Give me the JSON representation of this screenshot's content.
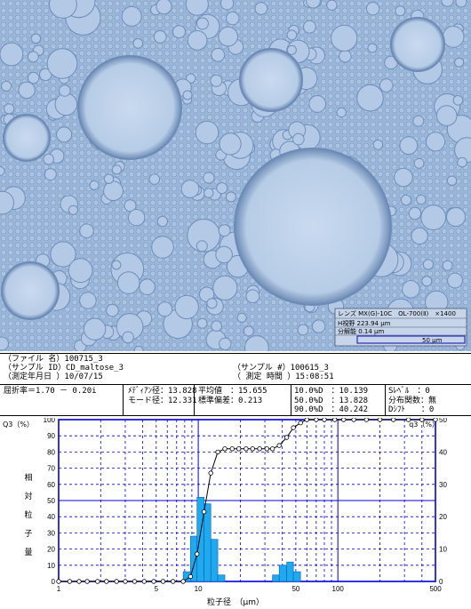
{
  "micro": {
    "lens_label": "レンズ",
    "lens_value": "MX(G)-10C　OL-700(Ⅱ)　×1400",
    "fov_label": "H視野",
    "fov_value": "223.94 μm",
    "res_label": "分解能",
    "res_value": "0.14 μm",
    "scale_label": "50 μm",
    "colors": {
      "background": "#9db9da",
      "particle_fill": "#bfd2ea",
      "particle_edge": "#6c8bb6"
    }
  },
  "header": {
    "file_label": "（ファイル 名）",
    "file_value": "100715_3",
    "sample_id_label": "（サンプル ID）",
    "sample_id_value": "CD_maltose_3",
    "date_label": "（測定年月日 ）",
    "date_value": "10/07/15",
    "sample_no_label": "（サンプル #）",
    "sample_no_value": "100615_3",
    "time_label": "（ 測定 時間 ）",
    "time_value": "15:08:51"
  },
  "stats": {
    "refractive": "屈折率＝1.70 － 0.20i",
    "median_label": "ﾒﾃﾞｨｱﾝ径：",
    "median_value": "13.828",
    "mode_label": "モード径：",
    "mode_value": "12.331",
    "mean_label": "平均値　：",
    "mean_value": "15.655",
    "sd_label": "標準偏差：",
    "sd_value": "0.213",
    "d10_label": "10.0%D　：",
    "d10_value": "10.139",
    "d50_label": "50.0%D　：",
    "d50_value": "13.828",
    "d90_label": "90.0%D　：",
    "d90_value": "40.242",
    "slevel_label": "Sﾚﾍﾞﾙ　：",
    "slevel_value": "0",
    "dist_label": "分布関数：",
    "dist_value": "無",
    "dshift_label": "Dｼﾌﾄ　　：",
    "dshift_value": "0"
  },
  "chart_data": {
    "type": "bar",
    "xscale": "log",
    "xlim": [
      1,
      500
    ],
    "xticks": [
      "1",
      "5",
      "10",
      "50",
      "100",
      "500"
    ],
    "xlabel": "粒子径　（μm）",
    "ylabel_left": "相対粒子量",
    "left_axis_title": "Q3（%）",
    "right_axis_title": "q3（%）",
    "ylim_left": [
      0,
      100
    ],
    "ylim_right": [
      0,
      50
    ],
    "yticks_left": [
      "0",
      "10",
      "20",
      "30",
      "40",
      "50",
      "60",
      "70",
      "80",
      "90",
      "100"
    ],
    "yticks_right": [
      "0",
      "10",
      "20",
      "30",
      "40",
      "50"
    ],
    "colors": {
      "axes": "#0000dd",
      "bars": "#1faaf0",
      "bar_edge": "#0a5fb0",
      "curve": "#000000"
    },
    "series": [
      {
        "kind": "bars (q3, right axis)",
        "bins": [
          [
            7.8,
            8.8,
            3
          ],
          [
            8.8,
            9.8,
            14
          ],
          [
            9.8,
            11.0,
            26
          ],
          [
            11.0,
            12.3,
            24
          ],
          [
            12.3,
            13.8,
            13
          ],
          [
            13.8,
            15.5,
            2
          ],
          [
            34,
            38,
            2
          ],
          [
            38,
            43,
            5
          ],
          [
            43,
            48,
            6
          ],
          [
            48,
            54,
            3
          ]
        ]
      },
      {
        "kind": "line (Q3 cumulative, left axis)",
        "points": [
          [
            1,
            0
          ],
          [
            1.2,
            0
          ],
          [
            1.4,
            0
          ],
          [
            1.6,
            0
          ],
          [
            1.9,
            0
          ],
          [
            2.2,
            0
          ],
          [
            2.6,
            0
          ],
          [
            3,
            0
          ],
          [
            3.5,
            0
          ],
          [
            4.1,
            0
          ],
          [
            4.8,
            0
          ],
          [
            5.6,
            0
          ],
          [
            6.6,
            0
          ],
          [
            7.8,
            0
          ],
          [
            8.8,
            3
          ],
          [
            9.8,
            17
          ],
          [
            11,
            43
          ],
          [
            12.3,
            67
          ],
          [
            13.8,
            80
          ],
          [
            15.5,
            82
          ],
          [
            17.5,
            82
          ],
          [
            19.5,
            82
          ],
          [
            22,
            82
          ],
          [
            24.5,
            82
          ],
          [
            27.5,
            82
          ],
          [
            31,
            82
          ],
          [
            34,
            82
          ],
          [
            38,
            84
          ],
          [
            43,
            89
          ],
          [
            48,
            95
          ],
          [
            54,
            98
          ],
          [
            60,
            100
          ],
          [
            70,
            100
          ],
          [
            80,
            100
          ],
          [
            95,
            100
          ],
          [
            110,
            100
          ],
          [
            130,
            100
          ],
          [
            160,
            100
          ],
          [
            200,
            100
          ],
          [
            250,
            100
          ],
          [
            320,
            100
          ],
          [
            400,
            100
          ],
          [
            500,
            100
          ]
        ]
      }
    ]
  }
}
